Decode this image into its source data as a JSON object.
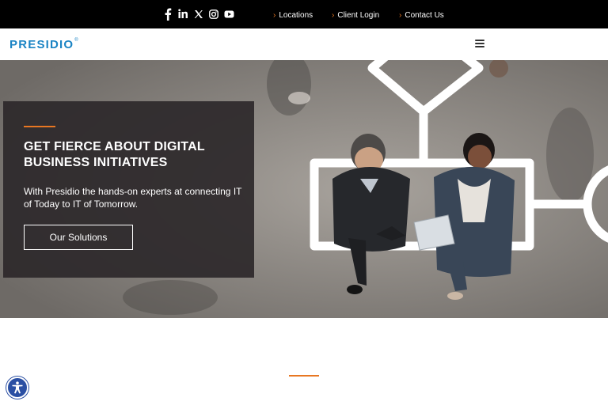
{
  "topbar": {
    "social": [
      {
        "name": "facebook-icon"
      },
      {
        "name": "linkedin-icon"
      },
      {
        "name": "x-twitter-icon"
      },
      {
        "name": "instagram-icon"
      },
      {
        "name": "youtube-icon"
      }
    ],
    "links": [
      {
        "label": "Locations"
      },
      {
        "label": "Client Login"
      },
      {
        "label": "Contact Us"
      }
    ]
  },
  "navbar": {
    "logo": "PRESIDIO",
    "logo_mark": "®",
    "menu_icon": "hamburger-menu-icon"
  },
  "hero": {
    "headline": "GET FIERCE ABOUT DIGITAL BUSINESS INITIATIVES",
    "subtext": "With Presidio the hands-on experts at connecting IT of Today to IT of Tomorrow.",
    "cta_label": "Our Solutions"
  },
  "accessibility": {
    "icon": "accessibility-icon"
  },
  "colors": {
    "accent": "#e87722",
    "brand": "#1b84c4",
    "topbar_bg": "#000000",
    "panel_bg": "#2d282a"
  }
}
